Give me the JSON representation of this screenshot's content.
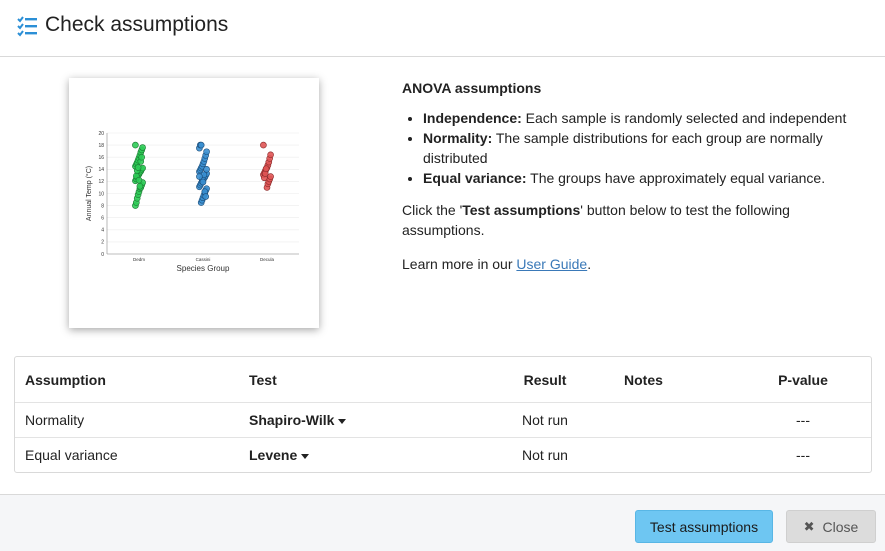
{
  "header": {
    "title": "Check assumptions",
    "icon": "checklist-icon"
  },
  "info": {
    "heading": "ANOVA assumptions",
    "bullets": [
      {
        "term": "Independence:",
        "text": " Each sample is randomly selected and independent"
      },
      {
        "term": "Normality:",
        "text": " The sample distributions for each group are normally distributed"
      },
      {
        "term": "Equal variance:",
        "text": " The groups have approximately equal variance."
      }
    ],
    "instruction_pre": "Click the '",
    "instruction_bold": "Test assumptions",
    "instruction_post": "' button below to test the following assumptions.",
    "learn_pre": "Learn more in our ",
    "learn_link": "User Guide",
    "learn_post": "."
  },
  "table": {
    "headers": {
      "assumption": "Assumption",
      "test": "Test",
      "result": "Result",
      "notes": "Notes",
      "pvalue": "P-value"
    },
    "rows": [
      {
        "assumption": "Normality",
        "test": "Shapiro-Wilk",
        "result": "Not run",
        "notes": "",
        "pvalue": "---"
      },
      {
        "assumption": "Equal variance",
        "test": "Levene",
        "result": "Not run",
        "notes": "",
        "pvalue": "---"
      }
    ]
  },
  "footer": {
    "test_button": "Test assumptions",
    "close_button": "Close",
    "close_icon": "close-icon"
  },
  "colors": {
    "accent_button": "#6ec6f2",
    "link": "#3a79b8",
    "group_green": "#2ecc56",
    "group_blue": "#3a8fd0",
    "group_red": "#e05555"
  },
  "chart_data": {
    "type": "scatter",
    "title": "",
    "xlabel": "Species Group",
    "ylabel": "Annual Temp (°C)",
    "ylim": [
      0,
      20
    ],
    "yticks": [
      0,
      2,
      4,
      6,
      8,
      10,
      12,
      14,
      16,
      18,
      20
    ],
    "categories": [
      "Dedm",
      "Cassini",
      "Decula"
    ],
    "grid": true,
    "series": [
      {
        "values": [
          8.0,
          8.5,
          9.2,
          9.8,
          10.3,
          10.8,
          11.0,
          11.4,
          11.8,
          12.1,
          12.4,
          12.7,
          13.0,
          13.2,
          13.5,
          13.7,
          14.0,
          14.2,
          14.5,
          14.8,
          15.1,
          15.5,
          15.9,
          16.3,
          16.8,
          17.2,
          17.6,
          18.0,
          12.9,
          13.8,
          14.3,
          12.2,
          11.2,
          15.3,
          16.0
        ]
      },
      {
        "values": [
          8.5,
          8.9,
          9.3,
          9.7,
          10.1,
          10.5,
          10.8,
          11.1,
          11.4,
          11.7,
          12.0,
          12.2,
          12.5,
          12.7,
          13.0,
          13.3,
          13.6,
          13.9,
          14.2,
          14.5,
          14.9,
          15.3,
          15.8,
          16.3,
          16.9,
          17.5,
          18.0,
          18.0,
          12.4,
          11.9,
          13.1,
          10.3,
          9.5,
          14.0,
          12.8
        ]
      },
      {
        "values": [
          11.0,
          11.6,
          12.0,
          12.4,
          12.8,
          13.1,
          13.4,
          13.7,
          14.0,
          14.3,
          14.7,
          15.2,
          15.8,
          16.4,
          18.0,
          12.6,
          13.3,
          14.1
        ]
      }
    ]
  }
}
